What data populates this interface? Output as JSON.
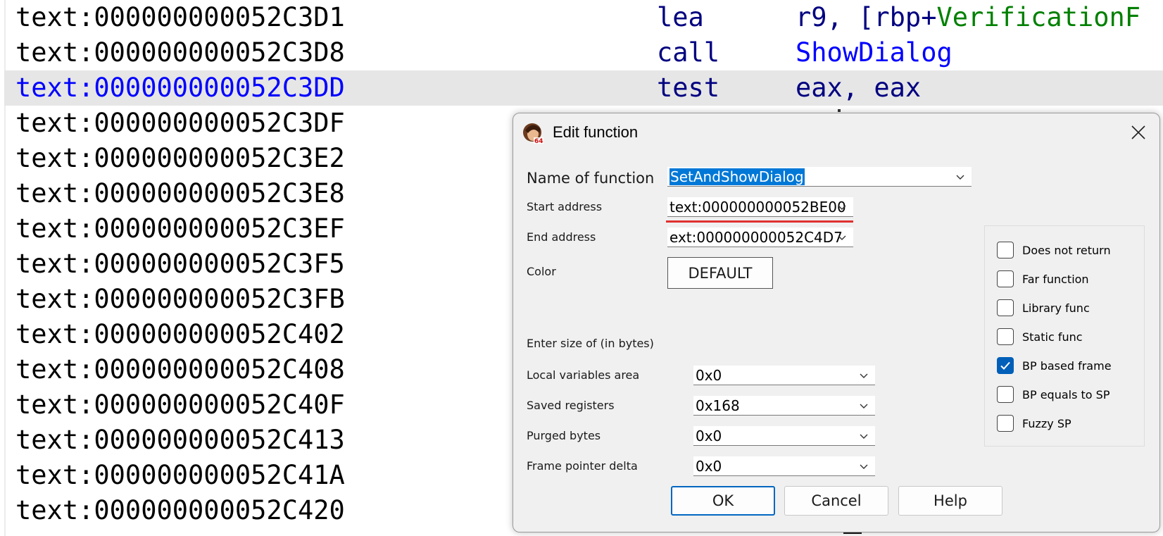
{
  "listing": {
    "rows": [
      {
        "addr": "text:000000000052C3D1",
        "mnem": "lea",
        "ops_pre": "r9, [rbp+",
        "ops_name": "",
        "ops_green": "VerificationF"
      },
      {
        "addr": "text:000000000052C3D8",
        "mnem": "call",
        "ops_pre": "",
        "ops_name": "ShowDialog",
        "ops_green": ""
      },
      {
        "addr": "text:000000000052C3DD",
        "mnem": "test",
        "ops_pre": "eax, eax",
        "ops_name": "",
        "ops_green": "",
        "selected": true
      },
      {
        "addr": "text:000000000052C3DF",
        "mnem": "",
        "ops_pre": "",
        "ops_name": "",
        "ops_green": ""
      },
      {
        "addr": "text:000000000052C3E2",
        "mnem": "",
        "ops_pre": "",
        "ops_name": "",
        "ops_green": ""
      },
      {
        "addr": "text:000000000052C3E8",
        "mnem": "",
        "ops_pre": "",
        "ops_name": "",
        "ops_green": ""
      },
      {
        "addr": "text:000000000052C3EF",
        "mnem": "",
        "ops_pre": "",
        "ops_name": "",
        "ops_green": ""
      },
      {
        "addr": "text:000000000052C3F5",
        "mnem": "",
        "ops_pre": "",
        "ops_name": "",
        "ops_green": ""
      },
      {
        "addr": "text:000000000052C3FB",
        "mnem": "",
        "ops_pre": "",
        "ops_name": "",
        "ops_green": ""
      },
      {
        "addr": "text:000000000052C402",
        "mnem": "",
        "ops_pre": "",
        "ops_name": "",
        "ops_green": ""
      },
      {
        "addr": "text:000000000052C408",
        "mnem": "",
        "ops_pre": "",
        "ops_name": "",
        "ops_green": ""
      },
      {
        "addr": "text:000000000052C40F",
        "mnem": "",
        "ops_pre": "",
        "ops_name": "",
        "ops_green": ""
      },
      {
        "addr": "text:000000000052C413",
        "mnem": "",
        "ops_pre": "",
        "ops_name": "",
        "ops_green": ""
      },
      {
        "addr": "text:000000000052C41A",
        "mnem": "",
        "ops_pre": "",
        "ops_name": "",
        "ops_green": ""
      },
      {
        "addr": "text:000000000052C420",
        "mnem": "",
        "ops_pre": "",
        "ops_name": "",
        "ops_green": ""
      }
    ]
  },
  "dialog": {
    "title": "Edit function",
    "icon": "ida-app-icon",
    "close_icon": "close-icon",
    "name_label": "Name of function",
    "name_value": "SetAndShowDialog",
    "start_label": "Start address",
    "start_value": "text:000000000052BE00",
    "end_label": "End address",
    "end_value": "ext:000000000052C4D7",
    "color_label": "Color",
    "color_button": "DEFAULT",
    "size_heading": "Enter size of (in bytes)",
    "local_label": "Local variables area",
    "local_value": "0x0",
    "saved_label": "Saved registers",
    "saved_value": "0x168",
    "purged_label": "Purged bytes",
    "purged_value": "0x0",
    "delta_label": "Frame pointer delta",
    "delta_value": "0x0",
    "flags": [
      {
        "label": "Does not return",
        "checked": false
      },
      {
        "label": "Far function",
        "checked": false
      },
      {
        "label": "Library func",
        "checked": false
      },
      {
        "label": "Static func",
        "checked": false
      },
      {
        "label": "BP based frame",
        "checked": true
      },
      {
        "label": "BP equals to SP",
        "checked": false
      },
      {
        "label": "Fuzzy SP",
        "checked": false
      }
    ],
    "ok": "OK",
    "cancel": "Cancel",
    "help": "Help"
  },
  "colors": {
    "selection": "#0078d7",
    "checkbox_checked": "#005fb8",
    "annotation_underline": "#e03030",
    "address_selected": "#0000ff"
  }
}
